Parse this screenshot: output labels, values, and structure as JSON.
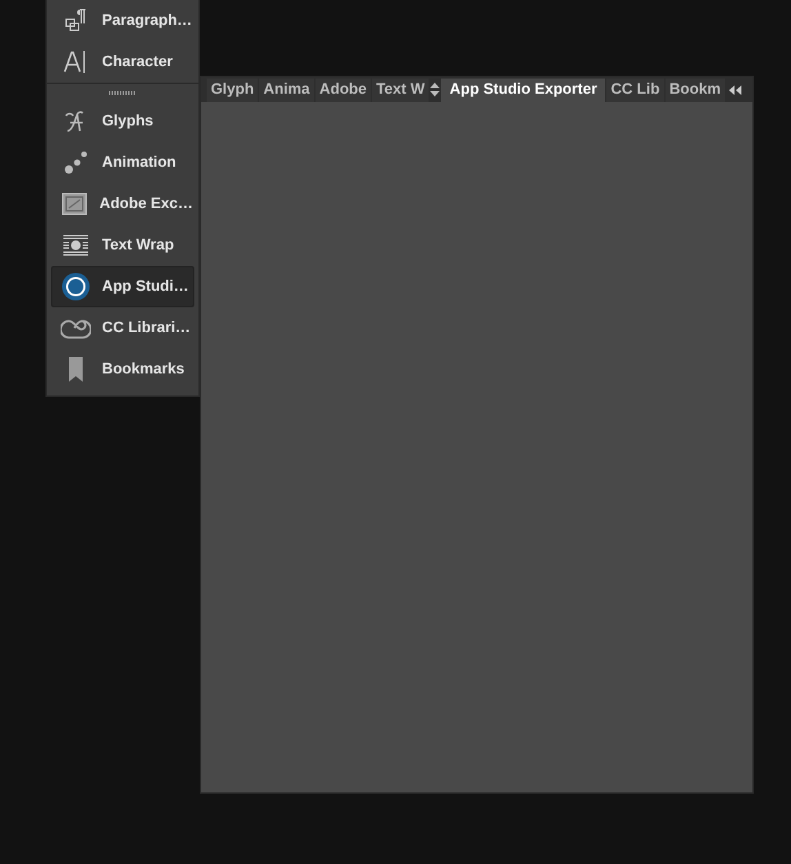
{
  "panel_menu": {
    "items": [
      {
        "kind": "item",
        "label": "Paragraph…",
        "selected": false
      },
      {
        "kind": "item",
        "label": "Character",
        "selected": false
      },
      {
        "kind": "grip"
      },
      {
        "kind": "item",
        "label": "Glyphs",
        "selected": false
      },
      {
        "kind": "item",
        "label": "Animation",
        "selected": false
      },
      {
        "kind": "item",
        "label": "Adobe Exc…",
        "selected": false
      },
      {
        "kind": "item",
        "label": "Text Wrap",
        "selected": false
      },
      {
        "kind": "item",
        "label": "App Studi…",
        "selected": true
      },
      {
        "kind": "item",
        "label": "CC Librari…",
        "selected": false
      },
      {
        "kind": "item",
        "label": "Bookmarks",
        "selected": false
      }
    ]
  },
  "panel": {
    "tabs": [
      {
        "label": "Glyph",
        "selected": false
      },
      {
        "label": "Anima",
        "selected": false
      },
      {
        "label": "Adobe",
        "selected": false
      },
      {
        "label": "Text W",
        "selected": false
      },
      {
        "label": "App Studio Exporter",
        "selected": true
      },
      {
        "label": "CC Lib",
        "selected": false
      },
      {
        "label": "Bookm",
        "selected": false
      }
    ]
  }
}
